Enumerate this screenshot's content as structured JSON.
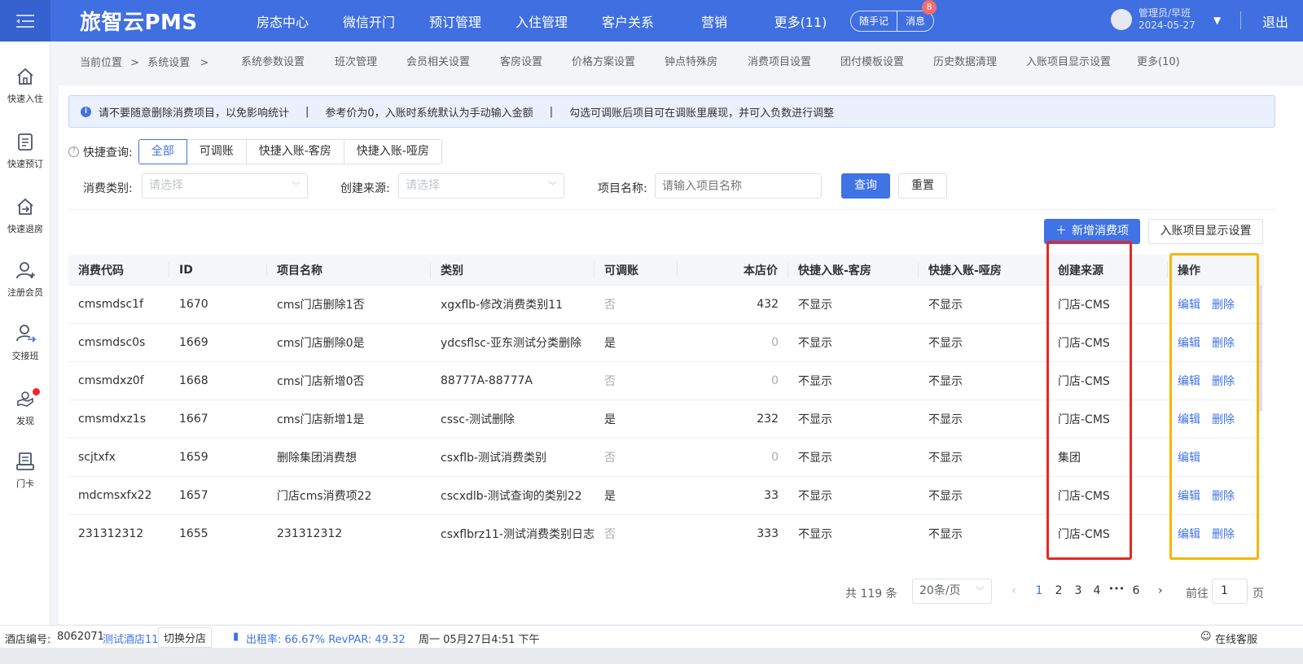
{
  "topbar": {
    "menu_icon": "menu-fold-icon",
    "brand": "旅智云PMS",
    "nav": [
      "房态中心",
      "微信开门",
      "预订管理",
      "入住管理",
      "客户关系",
      "营销",
      "更多(11)"
    ],
    "notes_btn": "随手记",
    "msg_btn": "消息",
    "msg_count": "8",
    "user_name": "管理员/早班",
    "user_date": "2024-05-27",
    "logout": "退出"
  },
  "sidebar": {
    "items": [
      {
        "label": "快速入住",
        "icon": "home-icon"
      },
      {
        "label": "快速预订",
        "icon": "clipboard-icon"
      },
      {
        "label": "快速退房",
        "icon": "home-exit-icon"
      },
      {
        "label": "注册会员",
        "icon": "user-add-icon"
      },
      {
        "label": "交接班",
        "icon": "user-swap-icon"
      },
      {
        "label": "发现",
        "icon": "discover-hand-icon"
      },
      {
        "label": "门卡",
        "icon": "card-reader-icon"
      }
    ]
  },
  "breadcrumb": {
    "current": "当前位置",
    "sep": ">",
    "page": "系统设置"
  },
  "subnav": [
    "系统参数设置",
    "班次管理",
    "会员相关设置",
    "客房设置",
    "价格方案设置",
    "钟点特殊房",
    "消费项目设置",
    "团付模板设置",
    "历史数据清理",
    "入账项目显示设置",
    "更多(10)"
  ],
  "alert": {
    "icon": "info-icon",
    "parts": [
      "请不要随意删除消费项目，以免影响统计",
      "参考价为0，入账时系统默认为手动输入金额",
      "勾选可调账后项目可在调账里展现，并可入负数进行调整"
    ],
    "sep": "|"
  },
  "quick": {
    "label": "快捷查询:",
    "tabs": [
      "全部",
      "可调账",
      "快捷入账-客房",
      "快捷入账-哑房"
    ],
    "active": "全部"
  },
  "filters": {
    "category_label": "消费类别:",
    "category_placeholder": "请选择",
    "source_label": "创建来源:",
    "source_placeholder": "请选择",
    "name_label": "项目名称:",
    "name_placeholder": "请输入项目名称",
    "query_btn": "查询",
    "reset_btn": "重置"
  },
  "actions": {
    "add_btn": "新增消费项",
    "display_btn": "入账项目显示设置"
  },
  "table": {
    "headers": [
      "消费代码",
      "ID",
      "项目名称",
      "类别",
      "可调账",
      "本店价",
      "快捷入账-客房",
      "快捷入账-哑房",
      "创建来源",
      "操作"
    ],
    "rows": [
      [
        "cmsmdsc1f",
        "1670",
        "cms门店删除1否",
        "xgxflb-修改消费类别11",
        "否",
        "432",
        "不显示",
        "不显示",
        "门店-CMS"
      ],
      [
        "cmsmdsc0s",
        "1669",
        "cms门店删除0是",
        "ydcsflsc-亚东测试分类删除",
        "是",
        "0",
        "不显示",
        "不显示",
        "门店-CMS"
      ],
      [
        "cmsmdxz0f",
        "1668",
        "cms门店新增0否",
        "88777A-88777A",
        "否",
        "0",
        "不显示",
        "不显示",
        "门店-CMS"
      ],
      [
        "cmsmdxz1s",
        "1667",
        "cms门店新增1是",
        "cssc-测试删除",
        "是",
        "232",
        "不显示",
        "不显示",
        "门店-CMS"
      ],
      [
        "scjtxfx",
        "1659",
        "删除集团消费想",
        "csxflb-测试消费类别",
        "否",
        "0",
        "不显示",
        "不显示",
        "集团"
      ],
      [
        "mdcmsxfx22",
        "1657",
        "门店cms消费项22",
        "cscxdlb-测试查询的类别22",
        "是",
        "33",
        "不显示",
        "不显示",
        "门店-CMS"
      ],
      [
        "231312312",
        "1655",
        "231312312",
        "csxflbrz11-测试消费类别日志",
        "否",
        "333",
        "不显示",
        "不显示",
        "门店-CMS"
      ]
    ],
    "edit": "编辑",
    "delete": "删除"
  },
  "pagination": {
    "total": "共 119 条",
    "page_size": "20条/页",
    "pages": [
      "1",
      "2",
      "3",
      "4",
      "6"
    ],
    "ellipsis": "•••",
    "current": "1",
    "goto_label": "前往",
    "goto_value": "1",
    "page_unit": "页"
  },
  "status": {
    "hotel_no_label": "酒店编号:",
    "hotel_no": "8062071",
    "hotel_name": "测试酒店11",
    "switch": "切换分店",
    "occupancy": "出租率: 66.67% RevPAR: 49.32",
    "datetime": "周一 05月27日4:51 下午",
    "service": "在线客服"
  },
  "colors": {
    "primary": "#3f73e6",
    "topbar": "#3f6fe0",
    "highlight_red": "#e8281f",
    "highlight_yellow": "#f7b500"
  }
}
